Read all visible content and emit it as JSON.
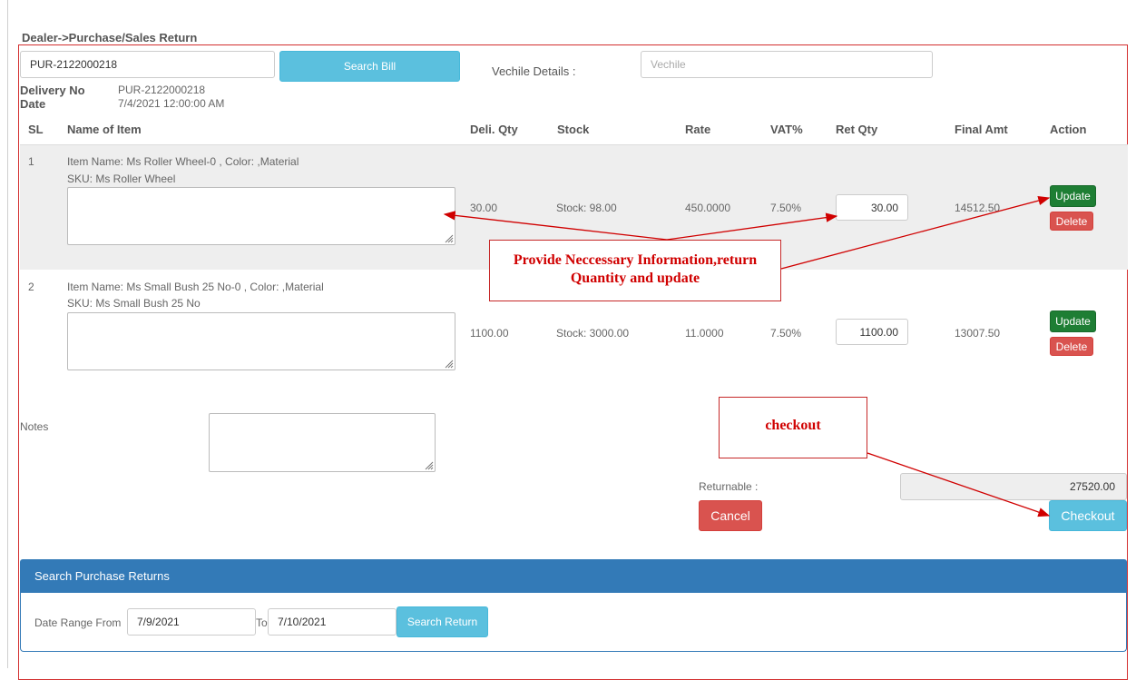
{
  "breadcrumb": "Dealer->Purchase/Sales Return",
  "search": {
    "bill_value": "PUR-2122000218",
    "search_button": "Search Bill",
    "vehicle_label": "Vechile Details :",
    "vehicle_placeholder": "Vechile"
  },
  "delivery": {
    "no_label": "Delivery No",
    "no_value": "PUR-2122000218",
    "date_label": "Date",
    "date_value": "7/4/2021 12:00:00 AM"
  },
  "table": {
    "headers": [
      "SL",
      "Name of Item",
      "Deli. Qty",
      "Stock",
      "Rate",
      "VAT%",
      "Ret Qty",
      "Final Amt",
      "Action"
    ],
    "rows": [
      {
        "sl": "1",
        "item_name": "Item Name: Ms Roller Wheel-0 , Color: ,Material",
        "sku": "SKU: Ms Roller Wheel",
        "deli_qty": "30.00",
        "stock": "Stock: 98.00",
        "rate": "450.0000",
        "vat": "7.50%",
        "ret_qty": "30.00",
        "final_amt": "14512.50",
        "update_label": "Update",
        "delete_label": "Delete"
      },
      {
        "sl": "2",
        "item_name": "Item Name: Ms Small Bush 25 No-0 , Color: ,Material",
        "sku": "SKU: Ms Small Bush 25 No",
        "deli_qty": "1100.00",
        "stock": "Stock: 3000.00",
        "rate": "11.0000",
        "vat": "7.50%",
        "ret_qty": "1100.00",
        "final_amt": "13007.50",
        "update_label": "Update",
        "delete_label": "Delete"
      }
    ]
  },
  "notes_label": "Notes",
  "returnable": {
    "label": "Returnable :",
    "value": "27520.00"
  },
  "cancel_label": "Cancel",
  "checkout_label": "Checkout",
  "callouts": {
    "info_line1": "Provide Neccessary Information,return",
    "info_line2": "Quantity and update",
    "checkout": "checkout"
  },
  "search_returns": {
    "title": "Search Purchase Returns",
    "from_label": "Date Range From",
    "from_value": "7/9/2021",
    "to_label": "To",
    "to_value": "7/10/2021",
    "search_button": "Search Return"
  },
  "colors": {
    "accent_primary": "#337ab7",
    "button_info": "#5bc0de",
    "button_success": "#1e7e34",
    "button_danger": "#d9534f",
    "annotation_red": "#d00000"
  }
}
